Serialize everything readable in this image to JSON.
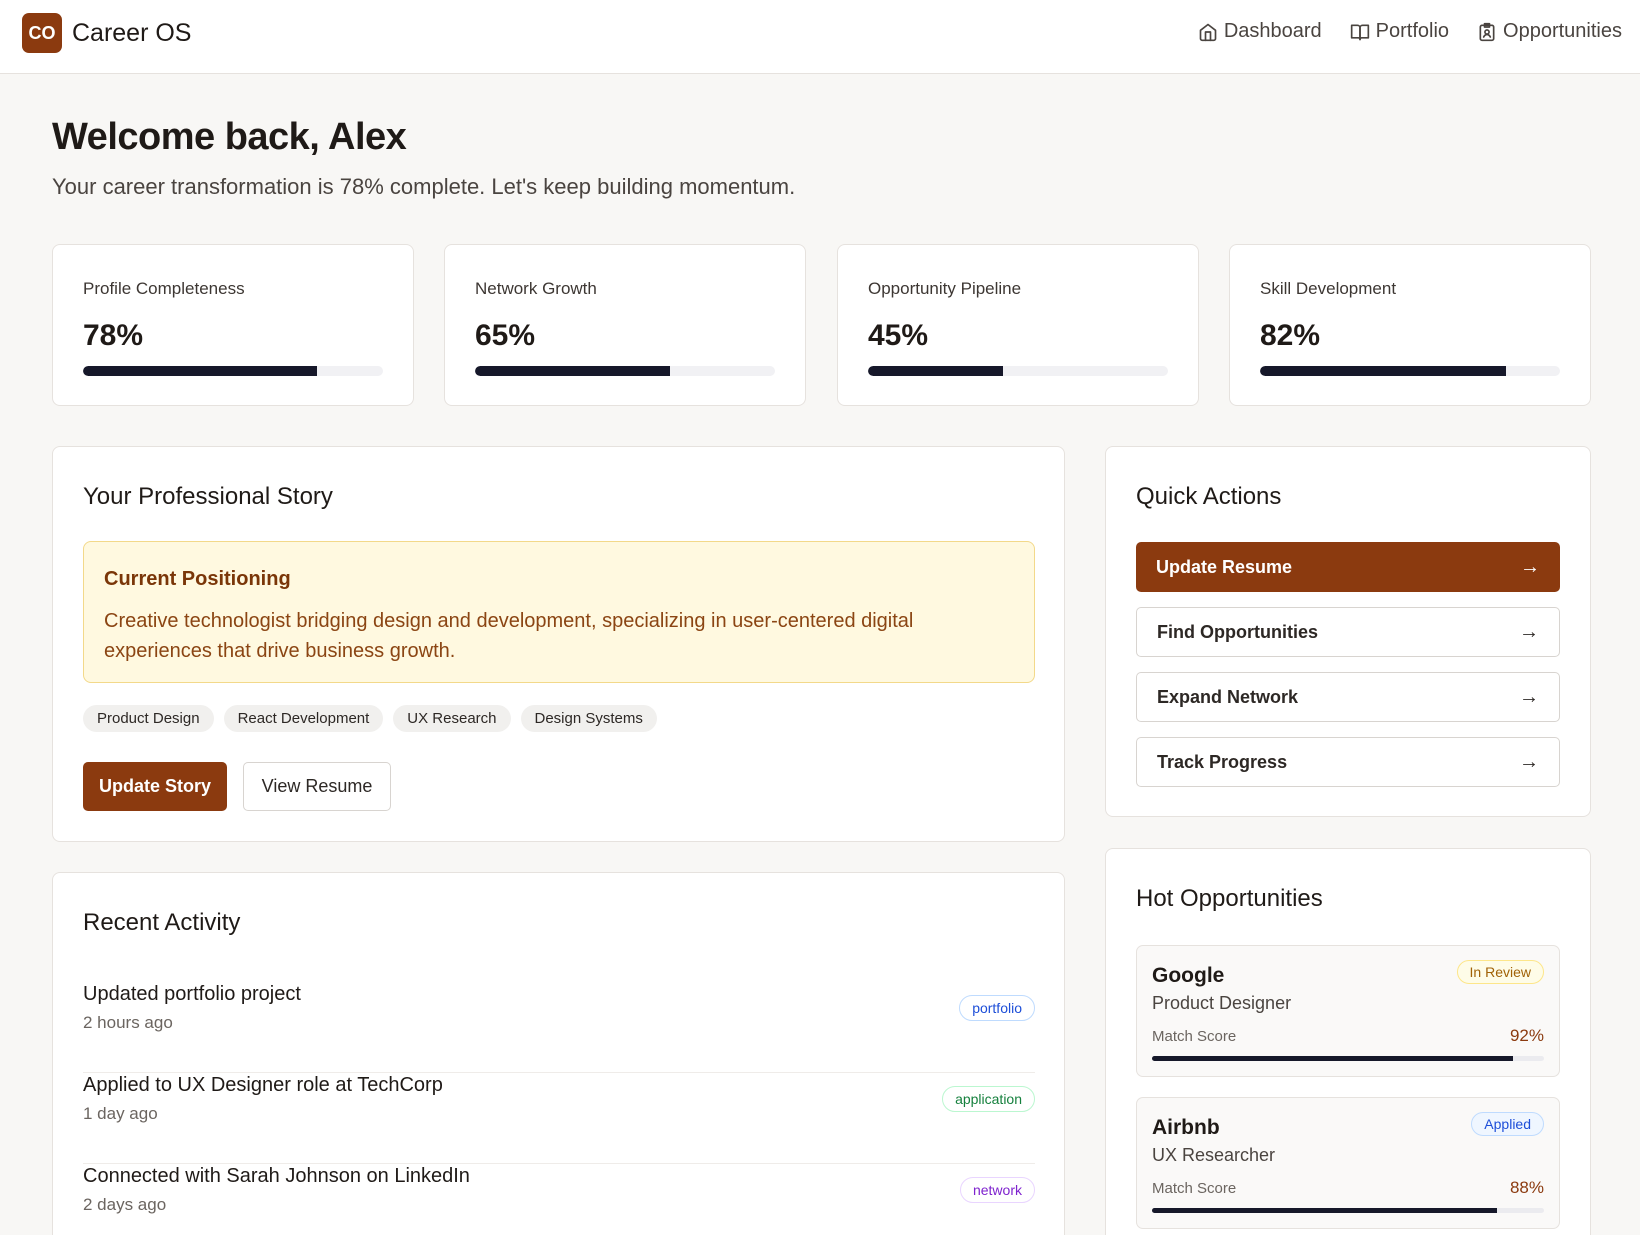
{
  "header": {
    "logo_mark": "CO",
    "app_name": "Career OS",
    "nav": [
      {
        "label": "Dashboard",
        "icon": "home-icon"
      },
      {
        "label": "Portfolio",
        "icon": "book-icon"
      },
      {
        "label": "Opportunities",
        "icon": "badge-icon"
      }
    ]
  },
  "welcome": {
    "title": "Welcome back, Alex",
    "subtitle": "Your career transformation is 78% complete. Let's keep building momentum."
  },
  "stats": [
    {
      "label": "Profile Completeness",
      "value": "78%",
      "progress": 78
    },
    {
      "label": "Network Growth",
      "value": "65%",
      "progress": 65
    },
    {
      "label": "Opportunity Pipeline",
      "value": "45%",
      "progress": 45
    },
    {
      "label": "Skill Development",
      "value": "82%",
      "progress": 82
    }
  ],
  "story": {
    "title": "Your Professional Story",
    "positioning_title": "Current Positioning",
    "positioning_text": "Creative technologist bridging design and development, specializing in user-centered digital experiences that drive business growth.",
    "tags": [
      "Product Design",
      "React Development",
      "UX Research",
      "Design Systems"
    ],
    "update_label": "Update Story",
    "view_label": "View Resume"
  },
  "activity": {
    "title": "Recent Activity",
    "items": [
      {
        "title": "Updated portfolio project",
        "time": "2 hours ago",
        "tag": "portfolio",
        "color": "#1d4ed8",
        "border": "#bfdbfe"
      },
      {
        "title": "Applied to UX Designer role at TechCorp",
        "time": "1 day ago",
        "tag": "application",
        "color": "#15803d",
        "border": "#bbf7d0"
      },
      {
        "title": "Connected with Sarah Johnson on LinkedIn",
        "time": "2 days ago",
        "tag": "network",
        "color": "#7e22ce",
        "border": "#e9d5ff"
      }
    ]
  },
  "quick_actions": {
    "title": "Quick Actions",
    "items": [
      "Update Resume",
      "Find Opportunities",
      "Expand Network",
      "Track Progress"
    ],
    "arrow": "→"
  },
  "opportunities": {
    "title": "Hot Opportunities",
    "match_label": "Match Score",
    "items": [
      {
        "company": "Google",
        "role": "Product Designer",
        "status": "In Review",
        "status_color": "#a16207",
        "status_bg": "#fefce8",
        "status_border": "#fde68a",
        "match": "92%",
        "match_value": 92
      },
      {
        "company": "Airbnb",
        "role": "UX Researcher",
        "status": "Applied",
        "status_color": "#1d4ed8",
        "status_bg": "#eff6ff",
        "status_border": "#bfdbfe",
        "match": "88%",
        "match_value": 88
      }
    ]
  },
  "colors": {
    "brand": "#8b3a0f",
    "progress": "#16182a",
    "background": "#f8f7f5"
  }
}
